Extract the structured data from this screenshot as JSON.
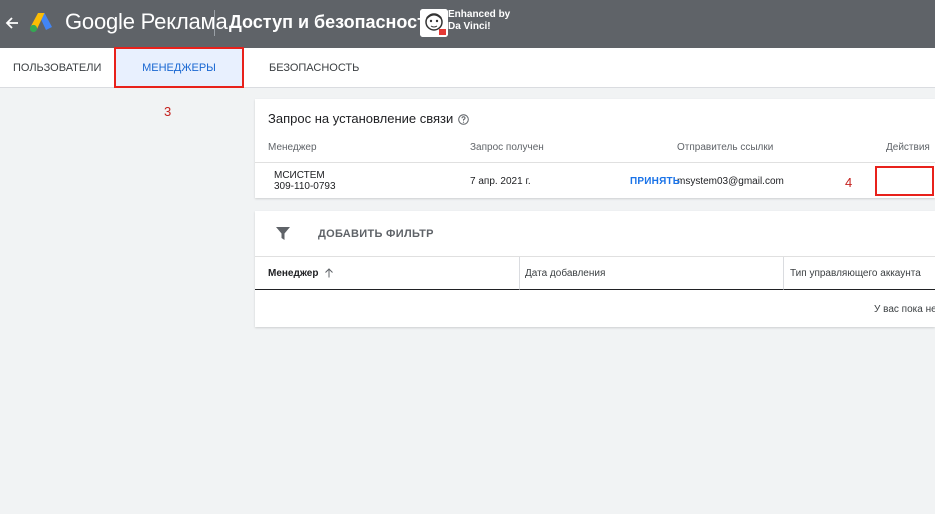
{
  "header": {
    "brand": "Google Реклама",
    "title": "Доступ и безопасность",
    "extension_text_line1": "Enhanced by",
    "extension_text_line2": "Da Vinci!"
  },
  "tabs": [
    {
      "label": "ПОЛЬЗОВАТЕЛИ",
      "active": false
    },
    {
      "label": "МЕНЕДЖЕРЫ",
      "active": true
    },
    {
      "label": "БЕЗОПАСНОСТЬ",
      "active": false
    }
  ],
  "annotations": {
    "tab_marker": "3",
    "accept_marker": "4"
  },
  "link_request": {
    "title": "Запрос на установление связи",
    "columns": [
      "Менеджер",
      "Запрос получен",
      "Отправитель ссылки",
      "Действия"
    ],
    "row": {
      "manager_name": "МСИСТЕМ",
      "manager_id": "309-110-0793",
      "received": "7 апр. 2021 г.",
      "sender": "msystem03@gmail.com",
      "action": "ПРИНЯТЬ"
    }
  },
  "managers_table": {
    "filter_label": "ДОБАВИТЬ ФИЛЬТР",
    "columns": [
      "Менеджер",
      "Дата добавления",
      "Тип управляющего аккаунта"
    ],
    "empty_text": "У вас пока не"
  },
  "colors": {
    "topbar": "#5f6368",
    "accent": "#1a73e8",
    "annotation": "#e8211b"
  }
}
